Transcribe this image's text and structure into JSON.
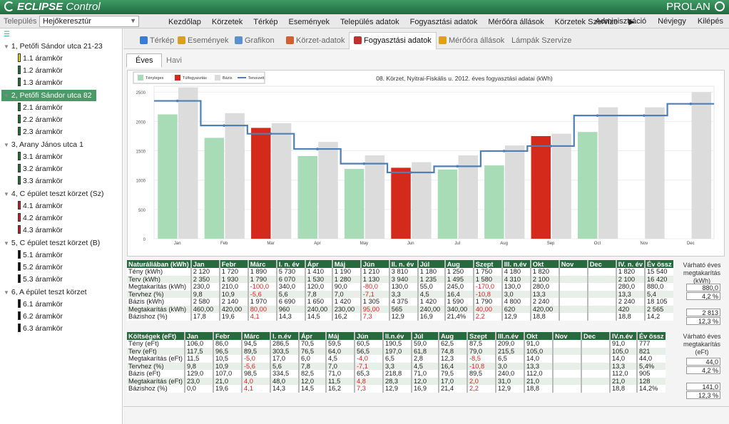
{
  "app": {
    "logo": "ECLIPSE",
    "logo_sub": "Control",
    "brand": "PROLAN"
  },
  "menubar": {
    "settlement_label": "Település",
    "settlement_value": "Hejőkeresztúr",
    "items": [
      "Kezdőlap",
      "Körzetek",
      "Térkép",
      "Események",
      "Település adatok",
      "Fogyasztási adatok",
      "Mérőóra állások",
      "Körzetek Szervize",
      "▶"
    ],
    "right": [
      "Adminisztráció",
      "Névjegy",
      "Kilépés"
    ]
  },
  "sidebar": {
    "nodes": [
      {
        "label": "1, Petőfi Sándor utca 21-23",
        "circuits": [
          {
            "label": "1.1 áramkör",
            "color": "#e8d820"
          },
          {
            "label": "1.2 áramkör",
            "color": "#1f7a2f"
          },
          {
            "label": "1.3 áramkör",
            "color": "#1f7a2f"
          }
        ]
      },
      {
        "label": "2, Petőfi Sándor utca 82",
        "selected": true,
        "circuits": [
          {
            "label": "2.1 áramkör",
            "color": "#1f7a2f"
          },
          {
            "label": "2.2 áramkör",
            "color": "#1f7a2f"
          },
          {
            "label": "2.3 áramkör",
            "color": "#1f7a2f"
          }
        ]
      },
      {
        "label": "3, Arany János utca 1",
        "circuits": [
          {
            "label": "3.1 áramkör",
            "color": "#1f7a2f"
          },
          {
            "label": "3.2 áramkör",
            "color": "#1f7a2f"
          },
          {
            "label": "3.3 áramkör",
            "color": "#1f7a2f"
          }
        ]
      },
      {
        "label": "4, C épület teszt körzet (Sz)",
        "circuits": [
          {
            "label": "4.1 áramkör",
            "color": "#c82020"
          },
          {
            "label": "4.2 áramkör",
            "color": "#c82020"
          },
          {
            "label": "4.3 áramkör",
            "color": "#c82020"
          }
        ]
      },
      {
        "label": "5, C épület teszt körzet (B)",
        "circuits": [
          {
            "label": "5.1 áramkör",
            "color": "#111111"
          },
          {
            "label": "5.2 áramkör",
            "color": "#111111"
          },
          {
            "label": "5.3 áramkör",
            "color": "#111111"
          }
        ]
      },
      {
        "label": "6, A épület teszt körzet",
        "circuits": [
          {
            "label": "6.1 áramkör",
            "color": "#111111"
          },
          {
            "label": "6.2 áramkör",
            "color": "#111111"
          },
          {
            "label": "6.3 áramkör",
            "color": "#111111"
          }
        ]
      }
    ]
  },
  "tabs": [
    {
      "label": "Térkép",
      "icon": "globe-icon",
      "color": "#3a7bd5"
    },
    {
      "label": "Események",
      "icon": "calendar-icon",
      "color": "#d9a020"
    },
    {
      "label": "Grafikon",
      "icon": "chart-icon",
      "color": "#5a8fd0"
    },
    {
      "label": "Körzet-adatok",
      "icon": "map-pin-icon",
      "color": "#d06030"
    },
    {
      "label": "Fogyasztási adatok",
      "icon": "bar-chart-icon",
      "color": "#c03030",
      "active": true
    },
    {
      "label": "Mérőóra állások",
      "icon": "gauge-icon",
      "color": "#e0a010"
    },
    {
      "label": "Lámpák Szervize",
      "icon": "",
      "color": ""
    }
  ],
  "subtabs": [
    {
      "label": "Éves",
      "active": true
    },
    {
      "label": "Havi"
    }
  ],
  "chart_data": {
    "type": "bar",
    "title": "08. Körzet, Nyitrai-Fiskális u.   2012. éves fogyasztási adatai (kWh)",
    "legend": [
      {
        "name": "Tényleges",
        "color": "#a8dcb6"
      },
      {
        "name": "Túlfogyasztás",
        "color": "#d42a1c"
      },
      {
        "name": "Bázis",
        "color": "#dcdcdc"
      },
      {
        "name": "Tervezett",
        "color": "#4f7fb5"
      }
    ],
    "categories": [
      "Jan",
      "Feb",
      "Mar",
      "Apr",
      "May",
      "Jun",
      "Jul",
      "Aug",
      "Sep",
      "Oct",
      "Nov",
      "Dec"
    ],
    "ylim": [
      0,
      2600
    ],
    "yticks": [
      0,
      500,
      1000,
      1500,
      2000,
      2500
    ],
    "series": [
      {
        "name": "Tényleges",
        "values": [
          2120,
          1720,
          1890,
          1410,
          1190,
          1210,
          1180,
          1250,
          1750,
          1820,
          null,
          null
        ]
      },
      {
        "name": "Bázis",
        "values": [
          2580,
          2140,
          1970,
          1650,
          1420,
          1305,
          1420,
          1590,
          1790,
          2240,
          2240,
          2500
        ]
      },
      {
        "name": "Tervezett",
        "values": [
          2350,
          1930,
          1790,
          1530,
          1280,
          1130,
          1235,
          1495,
          1580,
          2100,
          2100,
          2300
        ]
      }
    ],
    "overconsumption_months": [
      "Mar",
      "Jun",
      "Sep"
    ]
  },
  "table1": {
    "headers": [
      "Naturáliában (kWh)",
      "Jan",
      "Febr",
      "Márc",
      "I. n. év",
      "Ápr",
      "Máj",
      "Jún",
      "II. n. év",
      "Júl",
      "Aug",
      "Szept",
      "III. n.év",
      "Okt",
      "Nov",
      "Dec",
      "IV. n. év",
      "Év össz"
    ],
    "rows": [
      [
        "Tény (kWh)",
        "2 120",
        "1 720",
        "1 890",
        "5 730",
        "1 410",
        "1 190",
        "1 210",
        "3 810",
        "1 180",
        "1 250",
        "1 750",
        "4 180",
        "1 820",
        "",
        "",
        "1 820",
        "15 540"
      ],
      [
        "Terv (kWh)",
        "2 350",
        "1 930",
        "1 790",
        "6 070",
        "1 530",
        "1 280",
        "1 130",
        "3 940",
        "1 235",
        "1 495",
        "1 580",
        "4 310",
        "2 100",
        "",
        "",
        "2 100",
        "16 420"
      ],
      [
        "Megtakarítás (kWh)",
        "230,0",
        "210,0",
        "-100,0",
        "340,0",
        "120,0",
        "90,0",
        "-80,0",
        "130,0",
        "55,0",
        "245,0",
        "-170,0",
        "130,0",
        "280,0",
        "",
        "",
        "280,0",
        "880,0"
      ],
      [
        "Tervhez (%)",
        "9,8",
        "10,9",
        "-5,6",
        "5,6",
        "7,8",
        "7,0",
        "-7,1",
        "3,3",
        "4,5",
        "16,4",
        "-10,8",
        "3,0",
        "13,3",
        "",
        "",
        "13,3",
        "5,4"
      ],
      [
        "Bázis (kWh)",
        "2 580",
        "2 140",
        "1 970",
        "6 690",
        "1 650",
        "1 420",
        "1 305",
        "4 375",
        "1 420",
        "1 590",
        "1 790",
        "4 800",
        "2 240",
        "",
        "",
        "2 240",
        "18 105"
      ],
      [
        "Megtakarítás (kWh)",
        "460,00",
        "420,00",
        "80,00",
        "960",
        "240,00",
        "230,00",
        "95,00",
        "565",
        "240,00",
        "340,00",
        "40,00",
        "620",
        "420,00",
        "",
        "",
        "420",
        "2 565"
      ],
      [
        "Bázishoz (%)",
        "17,8",
        "19,6",
        "4,1",
        "14,3",
        "14,5",
        "16,2",
        "7,3",
        "12,9",
        "16,9",
        "21,4%",
        "2,2",
        "12,9",
        "18,8",
        "",
        "",
        "18,8",
        "14,2"
      ]
    ],
    "red_cells": [
      [
        2,
        3
      ],
      [
        2,
        7
      ],
      [
        2,
        11
      ],
      [
        3,
        3
      ],
      [
        3,
        7
      ],
      [
        3,
        11
      ],
      [
        5,
        3
      ],
      [
        5,
        7
      ],
      [
        5,
        11
      ],
      [
        6,
        3
      ],
      [
        6,
        7
      ],
      [
        6,
        11
      ]
    ],
    "summary_label": "Várható éves megtakarítás (kWh)",
    "summary_values": [
      "880,0",
      "4,2 %",
      "2 813",
      "12,3 %"
    ]
  },
  "table2": {
    "headers": [
      "Költségek (eFt)",
      "Jan",
      "Febr",
      "Márc",
      "I. n.év",
      "Ápr",
      "Máj",
      "Jún",
      "II.n.év",
      "Júl",
      "Aug",
      "Szept",
      "III.n.év",
      "Okt",
      "Nov",
      "Dec",
      "IV.n.év",
      "Év össz"
    ],
    "rows": [
      [
        "Tény (eFt)",
        "106,0",
        "86,0",
        "94,5",
        "286,5",
        "70,5",
        "59,5",
        "60,5",
        "190,5",
        "59,0",
        "62,5",
        "87,5",
        "209,0",
        "91,0",
        "",
        "",
        "91,0",
        "777"
      ],
      [
        "Terv (eFt)",
        "117,5",
        "96,5",
        "89,5",
        "303,5",
        "76,5",
        "64,0",
        "56,5",
        "197,0",
        "61,8",
        "74,8",
        "79,0",
        "215,5",
        "105,0",
        "",
        "",
        "105,0",
        "821"
      ],
      [
        "Megtakarítás (eFt)",
        "11,5",
        "10,5",
        "-5,0",
        "17,0",
        "6,0",
        "4,5",
        "-4,0",
        "6,5",
        "2,8",
        "12,3",
        "-8,5",
        "6,5",
        "14,0",
        "",
        "",
        "14,0",
        "44,0"
      ],
      [
        "Tervhez (%)",
        "9,8",
        "10,9",
        "-5,6",
        "5,6",
        "7,8",
        "7,0",
        "-7,1",
        "3,3",
        "4,5",
        "16,4",
        "-10,8",
        "3,0",
        "13,3",
        "",
        "",
        "13,3",
        "5,4%"
      ],
      [
        "Bázis (eFt)",
        "129,0",
        "107,0",
        "98,5",
        "334,5",
        "82,5",
        "71,0",
        "65,3",
        "218,8",
        "71,0",
        "79,5",
        "89,5",
        "240,0",
        "112,0",
        "",
        "",
        "112,0",
        "905"
      ],
      [
        "Megtakarítás (eFt)",
        "23,0",
        "21,0",
        "4,0",
        "48,0",
        "12,0",
        "11,5",
        "4,8",
        "28,3",
        "12,0",
        "17,0",
        "2,0",
        "31,0",
        "21,0",
        "",
        "",
        "21,0",
        "128"
      ],
      [
        "Bázishoz (%)",
        "0,0",
        "19,6",
        "4,1",
        "14,3",
        "14,5",
        "16,2",
        "7,3",
        "12,9",
        "16,9",
        "21,4",
        "2,2",
        "12,9",
        "18,8",
        "",
        "",
        "18,8",
        "14,2%"
      ]
    ],
    "red_cells": [
      [
        2,
        3
      ],
      [
        2,
        7
      ],
      [
        2,
        11
      ],
      [
        3,
        3
      ],
      [
        3,
        7
      ],
      [
        3,
        11
      ],
      [
        5,
        3
      ],
      [
        5,
        7
      ],
      [
        5,
        11
      ],
      [
        6,
        3
      ],
      [
        6,
        7
      ],
      [
        6,
        11
      ]
    ],
    "summary_label": "Várható éves megtakarítás (eFt)",
    "summary_values": [
      "44,0",
      "4,2 %",
      "141,0",
      "12,3 %"
    ]
  }
}
